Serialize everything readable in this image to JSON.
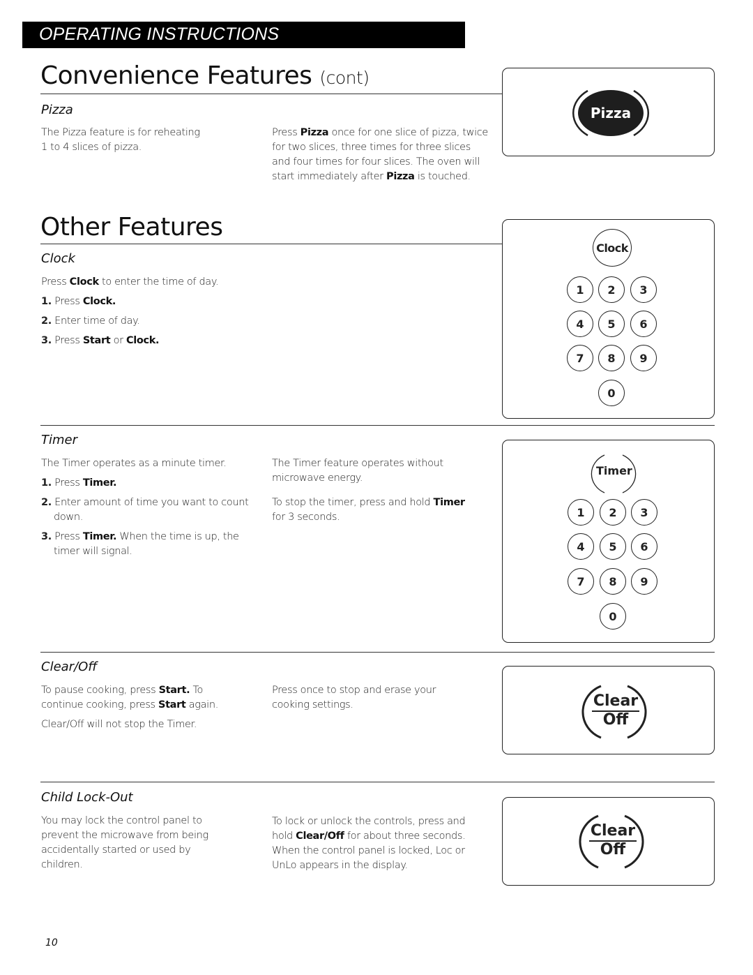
{
  "header": {
    "section_label": "OPERATING INSTRUCTIONS"
  },
  "convenience": {
    "title": "Convenience Features",
    "title_suffix": "(cont)",
    "pizza": {
      "heading": "Pizza",
      "left_text": [
        "The Pizza feature is for reheating",
        "1 to 4 slices of pizza."
      ],
      "right_text": {
        "p1": "Press ",
        "b1": "Pizza",
        "p2": " once for one slice of pizza, twice for two slices, three times for three slices and four times for four slices. The oven will start immediately after ",
        "b2": "Pizza",
        "p3": " is touched."
      },
      "button_label": "Pizza"
    }
  },
  "other": {
    "title": "Other Features",
    "clock": {
      "heading": "Clock",
      "intro": {
        "p1": "Press ",
        "b1": "Clock",
        "p2": " to enter the time of day."
      },
      "steps": [
        {
          "n": "1.",
          "p1": " Press ",
          "b1": "Clock.",
          "p2": "",
          "b2": ""
        },
        {
          "n": "2.",
          "p1": " Enter time of day.",
          "b1": "",
          "p2": "",
          "b2": ""
        },
        {
          "n": "3.",
          "p1": " Press ",
          "b1": "Start",
          "p2": " or ",
          "b2": "Clock."
        }
      ],
      "button_label": "Clock",
      "keypad": [
        "1",
        "2",
        "3",
        "4",
        "5",
        "6",
        "7",
        "8",
        "9",
        "0"
      ]
    },
    "timer": {
      "heading": "Timer",
      "intro": "The Timer operates as a minute timer.",
      "steps": [
        {
          "n": "1.",
          "p1": " Press ",
          "b1": "Timer.",
          "p2": ""
        },
        {
          "n": "2.",
          "p1": " Enter amount of time you want to count down.",
          "b1": "",
          "p2": ""
        },
        {
          "n": "3.",
          "p1": " Press ",
          "b1": "Timer.",
          "p2": " When the time is up, the timer will signal."
        }
      ],
      "right_p1": "The Timer feature operates without microwave energy.",
      "right_p2": {
        "p1": "To stop the timer, press and hold ",
        "b1": "Timer",
        "p2": " for 3 seconds."
      },
      "button_label": "Timer",
      "keypad": [
        "1",
        "2",
        "3",
        "4",
        "5",
        "6",
        "7",
        "8",
        "9",
        "0"
      ]
    },
    "clear_off": {
      "heading": "Clear/Off",
      "left_p1": {
        "p1": "To pause cooking, press ",
        "b1": "Start.",
        "p2": " To continue cooking, press ",
        "b2": "Start",
        "p3": " again."
      },
      "left_p2": "Clear/Off will not stop the Timer.",
      "right_p1": "Press once to stop and erase your cooking settings.",
      "button_top": "Clear",
      "button_bottom": "Off"
    },
    "child_lock": {
      "heading": "Child Lock-Out",
      "left_text": "You may lock the control panel to prevent the microwave from being accidentally started or used by children.",
      "right_text": {
        "p1": "To lock or unlock the controls, press and hold ",
        "b1": "Clear/Off",
        "p2": " for about three seconds. When the control panel is locked, Loc or UnLo appears in the display."
      },
      "button_top": "Clear",
      "button_bottom": "Off"
    }
  },
  "footer": {
    "page_number": "10"
  }
}
